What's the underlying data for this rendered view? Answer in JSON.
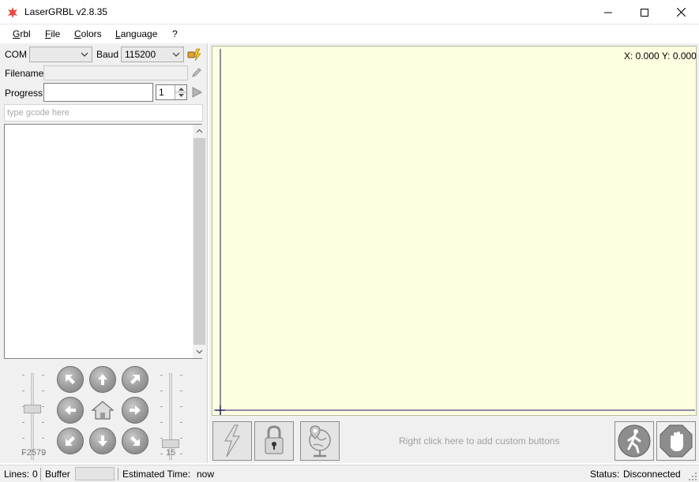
{
  "window": {
    "title": "LaserGRBL v2.8.35"
  },
  "menu": {
    "items": [
      "Grbl",
      "File",
      "Colors",
      "Language",
      "?"
    ]
  },
  "connection": {
    "com_label": "COM",
    "com_value": "",
    "baud_label": "Baud",
    "baud_value": "115200"
  },
  "file": {
    "filename_label": "Filename",
    "filename_value": "",
    "progress_label": "Progress",
    "progress_value": 0,
    "copies": "1"
  },
  "gcode_input": {
    "placeholder": "type gcode here"
  },
  "jog": {
    "speed_label": "F2579",
    "step_label": "15",
    "speed_level": 0.6,
    "step_level": 0.15
  },
  "canvas": {
    "coords": "X: 0.000 Y: 0.000",
    "background": "#ffffe1",
    "custom_hint": "Right click here to add custom buttons"
  },
  "statusbar": {
    "lines_label": "Lines:",
    "lines_value": "0",
    "buffer_label": "Buffer",
    "estimated_label": "Estimated Time:",
    "estimated_value": "now",
    "status_label": "Status:",
    "status_value": "Disconnected"
  },
  "colors": {
    "accent_icon": "#e8483f",
    "canvas_bg": "#ffffe1",
    "axis": "#1b1b6a"
  }
}
